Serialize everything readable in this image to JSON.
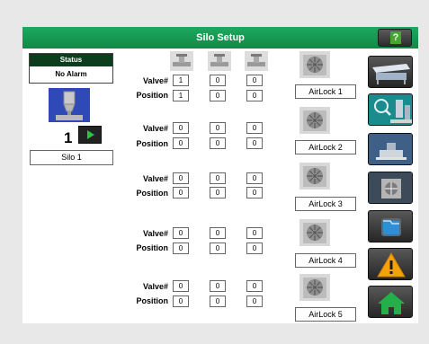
{
  "header": {
    "title": "Silo Setup",
    "help_icon": "help-icon"
  },
  "status": {
    "heading": "Status",
    "value": "No Alarm"
  },
  "silo": {
    "number": "1",
    "label": "Silo 1"
  },
  "labels": {
    "valve": "Valve#",
    "position": "Position"
  },
  "rows": [
    {
      "valves": [
        "1",
        "0",
        "0"
      ],
      "positions": [
        "1",
        "0",
        "0"
      ],
      "airlock": "AirLock 1"
    },
    {
      "valves": [
        "0",
        "0",
        "0"
      ],
      "positions": [
        "0",
        "0",
        "0"
      ],
      "airlock": "AirLock 2"
    },
    {
      "valves": [
        "0",
        "0",
        "0"
      ],
      "positions": [
        "0",
        "0",
        "0"
      ],
      "airlock": "AirLock 3"
    },
    {
      "valves": [
        "0",
        "0",
        "0"
      ],
      "positions": [
        "0",
        "0",
        "0"
      ],
      "airlock": "AirLock 4"
    },
    {
      "valves": [
        "0",
        "0",
        "0"
      ],
      "positions": [
        "0",
        "0",
        "0"
      ],
      "airlock": "AirLock 5"
    }
  ],
  "sidebar": [
    {
      "icon": "conveyor-icon"
    },
    {
      "icon": "zoom-silo-icon"
    },
    {
      "icon": "scale-icon"
    },
    {
      "icon": "airlock-icon"
    },
    {
      "icon": "folder-icon"
    },
    {
      "icon": "warning-icon"
    },
    {
      "icon": "home-icon"
    }
  ],
  "colors": {
    "header": "#1da860",
    "status_header": "#0c3d1c",
    "silo_bg": "#2f4ab7",
    "sidebar": "#3a3a3a"
  }
}
